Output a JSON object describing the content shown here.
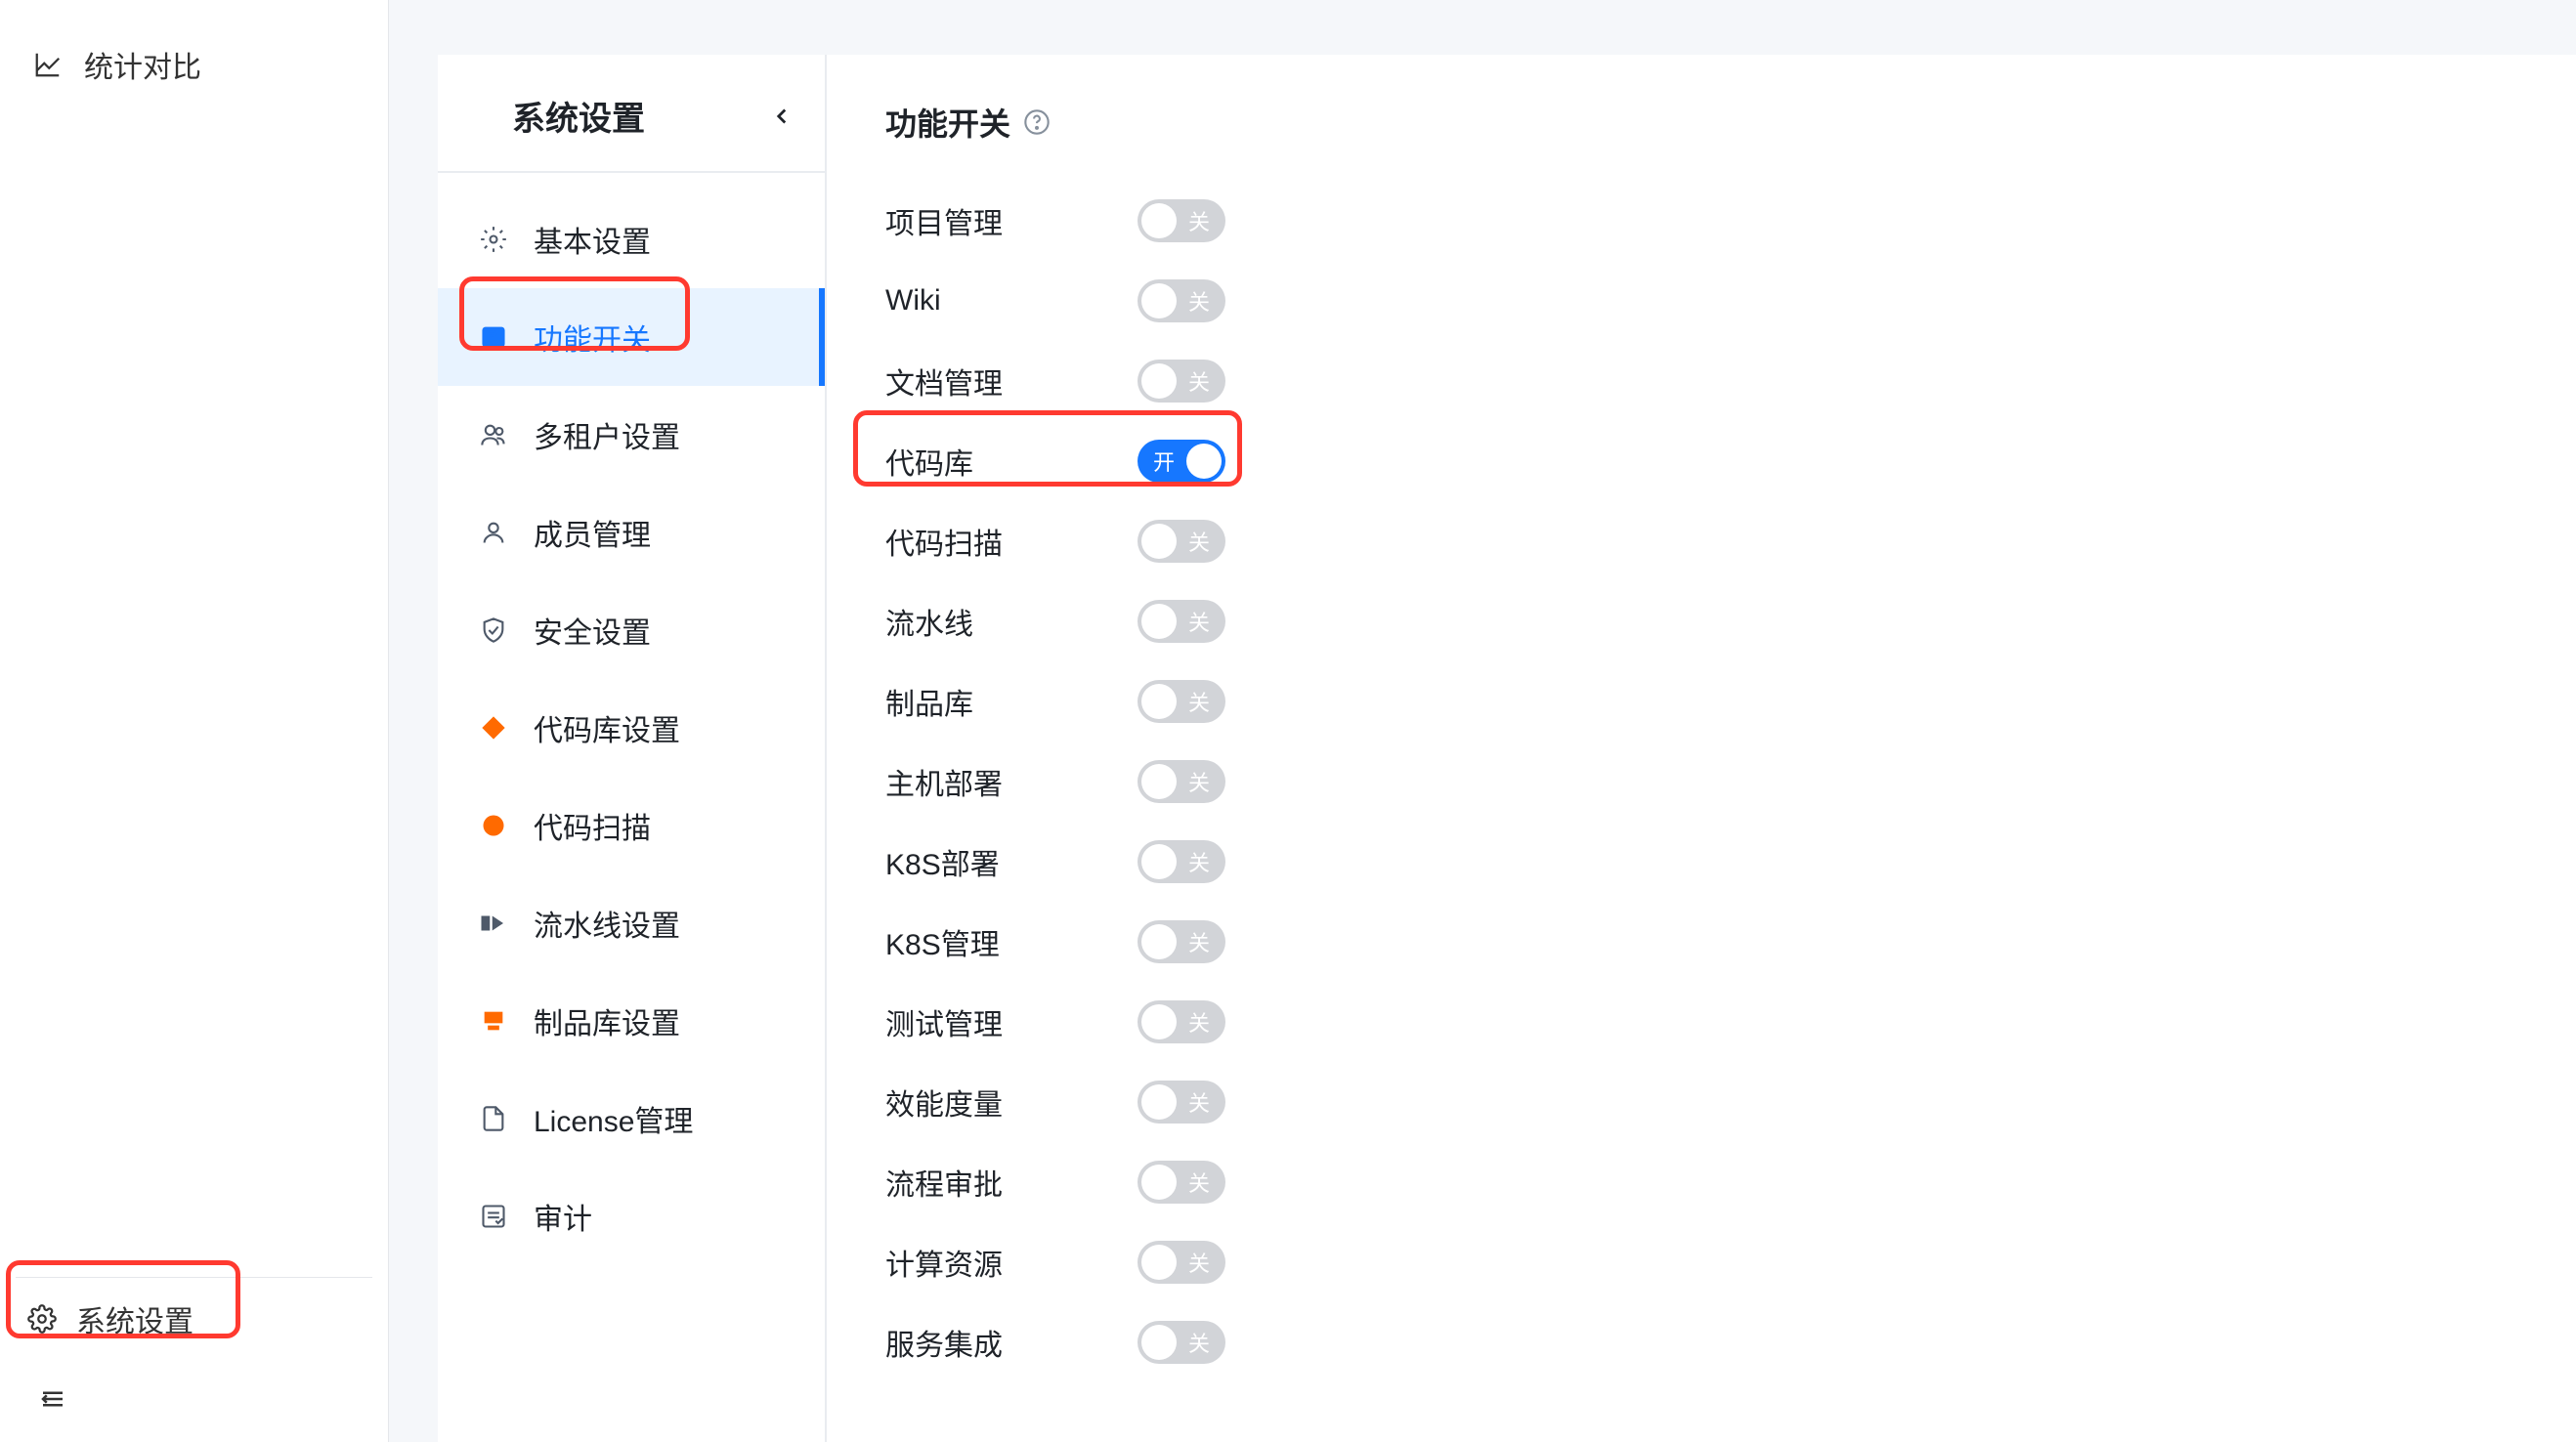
{
  "leftNav": {
    "top": {
      "label": "统计对比"
    },
    "bottom": {
      "label": "系统设置"
    }
  },
  "secondary": {
    "title": "系统设置",
    "items": [
      {
        "label": "基本设置",
        "icon": "gear"
      },
      {
        "label": "功能开关",
        "icon": "switch"
      },
      {
        "label": "多租户设置",
        "icon": "users"
      },
      {
        "label": "成员管理",
        "icon": "user"
      },
      {
        "label": "安全设置",
        "icon": "shield"
      },
      {
        "label": "代码库设置",
        "icon": "diamond"
      },
      {
        "label": "代码扫描",
        "icon": "circle"
      },
      {
        "label": "流水线设置",
        "icon": "pipeline"
      },
      {
        "label": "制品库设置",
        "icon": "artifact"
      },
      {
        "label": "License管理",
        "icon": "file"
      },
      {
        "label": "审计",
        "icon": "audit"
      }
    ],
    "activeIndex": 1
  },
  "content": {
    "title": "功能开关",
    "toggleOnText": "开",
    "toggleOffText": "关",
    "toggles": [
      {
        "label": "项目管理",
        "on": false
      },
      {
        "label": "Wiki",
        "on": false
      },
      {
        "label": "文档管理",
        "on": false
      },
      {
        "label": "代码库",
        "on": true
      },
      {
        "label": "代码扫描",
        "on": false
      },
      {
        "label": "流水线",
        "on": false
      },
      {
        "label": "制品库",
        "on": false
      },
      {
        "label": "主机部署",
        "on": false
      },
      {
        "label": "K8S部署",
        "on": false
      },
      {
        "label": "K8S管理",
        "on": false
      },
      {
        "label": "测试管理",
        "on": false
      },
      {
        "label": "效能度量",
        "on": false
      },
      {
        "label": "流程审批",
        "on": false
      },
      {
        "label": "计算资源",
        "on": false
      },
      {
        "label": "服务集成",
        "on": false
      }
    ]
  }
}
